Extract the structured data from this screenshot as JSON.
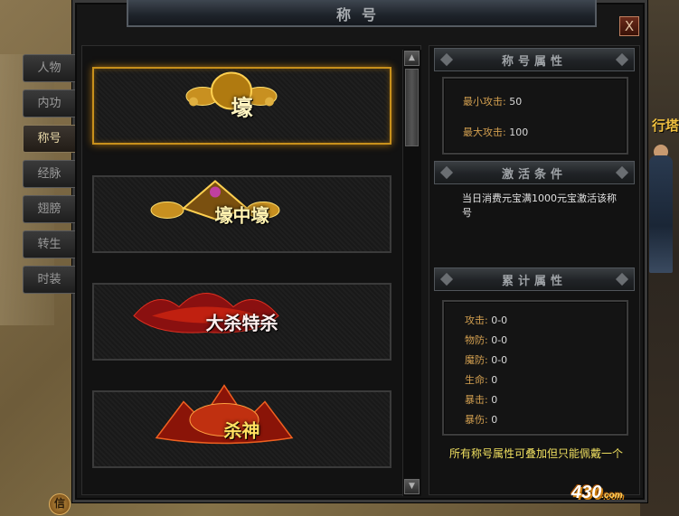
{
  "window": {
    "title": "称号",
    "close_label": "X"
  },
  "tabs": [
    {
      "label": "人物",
      "active": false
    },
    {
      "label": "内功",
      "active": false
    },
    {
      "label": "称号",
      "active": true
    },
    {
      "label": "经脉",
      "active": false
    },
    {
      "label": "翅膀",
      "active": false
    },
    {
      "label": "转生",
      "active": false
    },
    {
      "label": "时装",
      "active": false
    }
  ],
  "titles_list": [
    {
      "name": "壕",
      "selected": true
    },
    {
      "name": "壕中壕",
      "selected": false
    },
    {
      "name": "大杀特杀",
      "selected": false
    },
    {
      "name": "杀神",
      "selected": false
    }
  ],
  "title_attributes": {
    "header": "称号属性",
    "min_attack_label": "最小攻击:",
    "min_attack_value": "50",
    "max_attack_label": "最大攻击:",
    "max_attack_value": "100"
  },
  "activation": {
    "header": "激活条件",
    "text": "当日消费元宝满1000元宝激活该称号"
  },
  "cumulative": {
    "header": "累计属性",
    "rows": [
      {
        "label": "攻击:",
        "value": "0-0"
      },
      {
        "label": "物防:",
        "value": "0-0"
      },
      {
        "label": "魔防:",
        "value": "0-0"
      },
      {
        "label": "生命:",
        "value": "0"
      },
      {
        "label": "暴击:",
        "value": "0"
      },
      {
        "label": "暴伤:",
        "value": "0"
      }
    ]
  },
  "note": "所有称号属性可叠加但只能佩戴一个",
  "scene": {
    "tower_label": "行塔",
    "corner_button": "信"
  },
  "watermark": {
    "main": "430",
    "suffix": ".com"
  },
  "colors": {
    "accent_gold": "#d4a050",
    "note_yellow": "#f0e060",
    "selected_border": "#c8901c"
  }
}
